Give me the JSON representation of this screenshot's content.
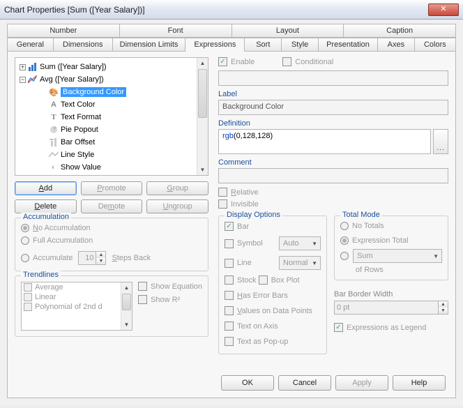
{
  "title": "Chart Properties [Sum ([Year Salary])]",
  "tabs_row1": [
    "Number",
    "Font",
    "Layout",
    "Caption"
  ],
  "tabs_row2": [
    "General",
    "Dimensions",
    "Dimension Limits",
    "Expressions",
    "Sort",
    "Style",
    "Presentation",
    "Axes",
    "Colors"
  ],
  "tree": {
    "items": [
      {
        "pm": "+",
        "label": "Sum ([Year Salary])",
        "ic": "bar"
      },
      {
        "pm": "−",
        "label": "Avg ([Year Salary])",
        "ic": "avg"
      }
    ],
    "children": [
      {
        "ic": "pal",
        "label": "Background Color",
        "sel": true
      },
      {
        "ic": "A",
        "label": "Text Color"
      },
      {
        "ic": "T",
        "label": "Text Format"
      },
      {
        "ic": "pie",
        "label": "Pie Popout"
      },
      {
        "ic": "off",
        "label": "Bar Offset"
      },
      {
        "ic": "line",
        "label": "Line Style"
      },
      {
        "ic": "eye",
        "label": "Show Value"
      }
    ]
  },
  "buttons": {
    "add": "Add",
    "promote": "Promote",
    "group": "Group",
    "delete": "Delete",
    "demote": "Demote",
    "ungroup": "Ungroup"
  },
  "accumulation": {
    "title": "Accumulation",
    "no": "No Accumulation",
    "full": "Full Accumulation",
    "acc": "Accumulate",
    "value": "10",
    "steps": "Steps Back"
  },
  "trend": {
    "title": "Trendlines",
    "avg": "Average",
    "lin": "Linear",
    "poly": "Polynomial of 2nd d",
    "eq": "Show Equation",
    "r2": "Show R²"
  },
  "right": {
    "enable": "Enable",
    "cond": "Conditional",
    "label_t": "Label",
    "label_v": "Background Color",
    "def_t": "Definition",
    "def_v": "rgb(0,128,128)",
    "comment_t": "Comment",
    "rel": "Relative",
    "inv": "Invisible"
  },
  "display": {
    "title": "Display Options",
    "bar": "Bar",
    "symbol": "Symbol",
    "combo1": "Auto",
    "line": "Line",
    "combo2": "Normal",
    "stock": "Stock",
    "box": "Box Plot",
    "err": "Has Error Bars",
    "vdp": "Values on Data Points",
    "toa": "Text on Axis",
    "tap": "Text as Pop-up"
  },
  "total": {
    "title": "Total Mode",
    "nt": "No Totals",
    "et": "Expression Total",
    "sum": "Sum",
    "rows": "of Rows"
  },
  "bbw": {
    "title": "Bar Border Width",
    "val": "0 pt",
    "leg": "Expressions as Legend"
  },
  "footer": {
    "ok": "OK",
    "cancel": "Cancel",
    "apply": "Apply",
    "help": "Help"
  }
}
